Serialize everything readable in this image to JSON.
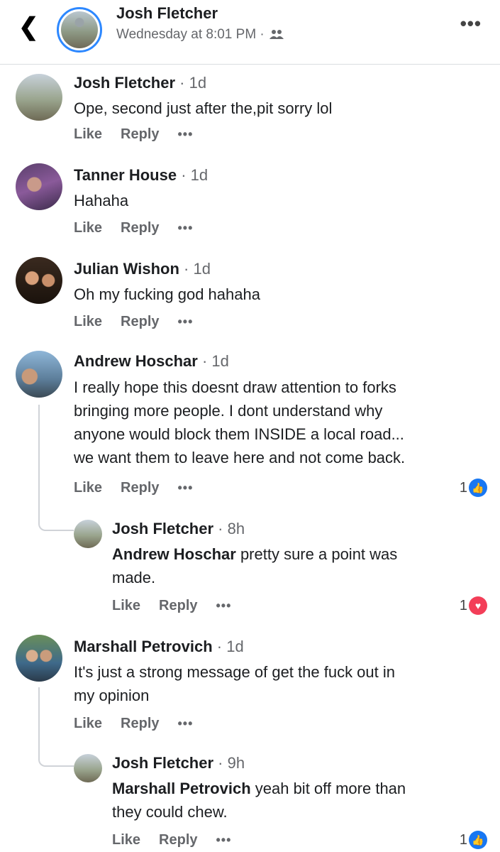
{
  "header": {
    "back_icon": "chevron-left-icon",
    "name": "Josh Fletcher",
    "subtitle": "Wednesday at 8:01 PM ·",
    "privacy_icon": "friends-icon",
    "more_icon": "more-icon"
  },
  "comments": [
    {
      "name": "Josh Fletcher",
      "time": "· 1d",
      "text": "Ope, second just after the,pit sorry lol",
      "like": "Like",
      "reply": "Reply"
    },
    {
      "name": "Tanner House",
      "time": "· 1d",
      "text": "Hahaha",
      "like": "Like",
      "reply": "Reply"
    },
    {
      "name": "Julian Wishon",
      "time": "· 1d",
      "text": "Oh my fucking god hahaha",
      "like": "Like",
      "reply": "Reply"
    },
    {
      "name": "Andrew Hoschar",
      "time": "· 1d",
      "lines": [
        "I really hope this doesnt draw attention to forks",
        "bringing more people. I dont understand why",
        "anyone would block them INSIDE a local road...",
        "we want them to leave here and not come back."
      ],
      "like": "Like",
      "reply": "Reply",
      "reaction_count": "1",
      "reaction": "like"
    },
    {
      "name": "Josh Fletcher",
      "time": "· 8h",
      "mention": "Andrew Hoschar",
      "line1_rest": " pretty sure a point was",
      "line2": "made.",
      "like": "Like",
      "reply": "Reply",
      "reaction_count": "1",
      "reaction": "love"
    },
    {
      "name": "Marshall Petrovich",
      "time": "· 1d",
      "lines": [
        "It's just a strong message of get the fuck out in",
        "my opinion"
      ],
      "like": "Like",
      "reply": "Reply"
    },
    {
      "name": "Josh Fletcher",
      "time": "· 9h",
      "mention": "Marshall Petrovich",
      "line1_rest": " yeah bit off more than",
      "line2": "they could chew.",
      "like": "Like",
      "reply": "Reply",
      "reaction_count": "1",
      "reaction": "like"
    }
  ],
  "colors": {
    "like_blue": "#1877f2",
    "love_red": "#f33e58",
    "accent_ring": "#2d88ff"
  }
}
